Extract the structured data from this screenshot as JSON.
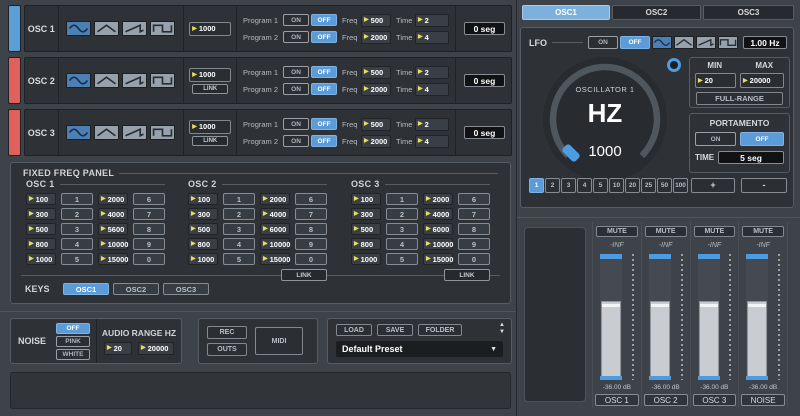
{
  "colors": {
    "accent": "#5b9bd8",
    "osc1_bar": "#5b9fd8",
    "osc2_bar": "#e0605c",
    "osc3_bar": "#e0605c",
    "fader_cap": "#4d9be0"
  },
  "left": {
    "labels": {
      "on": "ON",
      "off": "OFF",
      "freq": "Freq",
      "time": "Time",
      "link": "LINK"
    },
    "osc_rows": [
      {
        "label": "OSC 1",
        "bar_color": "#5b9fd8",
        "value": "1000",
        "display": "0 seg",
        "programs": [
          {
            "label": "Program 1",
            "freq": "500",
            "time": "2"
          },
          {
            "label": "Program 2",
            "freq": "2000",
            "time": "4"
          }
        ]
      },
      {
        "label": "OSC 2",
        "bar_color": "#e0605c",
        "value": "1000",
        "display": "0 seg",
        "programs": [
          {
            "label": "Program 1",
            "freq": "500",
            "time": "2"
          },
          {
            "label": "Program 2",
            "freq": "2000",
            "time": "4"
          }
        ]
      },
      {
        "label": "OSC 3",
        "bar_color": "#e0605c",
        "value": "1000",
        "display": "0 seg",
        "programs": [
          {
            "label": "Program 1",
            "freq": "500",
            "time": "2"
          },
          {
            "label": "Program 2",
            "freq": "2000",
            "time": "4"
          }
        ]
      }
    ],
    "fixed_panel": {
      "title": "FIXED FREQ PANEL",
      "link_label": "LINK",
      "groups": [
        {
          "title": "OSC 1",
          "pairs": [
            [
              "100",
              "1"
            ],
            [
              "300",
              "2"
            ],
            [
              "500",
              "3"
            ],
            [
              "800",
              "4"
            ],
            [
              "1000",
              "5"
            ],
            [
              "2000",
              "6"
            ],
            [
              "4000",
              "7"
            ],
            [
              "5600",
              "8"
            ],
            [
              "10000",
              "9"
            ],
            [
              "15000",
              "0"
            ]
          ]
        },
        {
          "title": "OSC 2",
          "pairs": [
            [
              "100",
              "1"
            ],
            [
              "300",
              "2"
            ],
            [
              "500",
              "3"
            ],
            [
              "800",
              "4"
            ],
            [
              "1000",
              "5"
            ],
            [
              "2000",
              "6"
            ],
            [
              "4000",
              "7"
            ],
            [
              "6000",
              "8"
            ],
            [
              "10000",
              "9"
            ],
            [
              "15000",
              "0"
            ]
          ]
        },
        {
          "title": "OSC 3",
          "pairs": [
            [
              "100",
              "1"
            ],
            [
              "300",
              "2"
            ],
            [
              "500",
              "3"
            ],
            [
              "800",
              "4"
            ],
            [
              "1000",
              "5"
            ],
            [
              "2000",
              "6"
            ],
            [
              "4000",
              "7"
            ],
            [
              "6000",
              "8"
            ],
            [
              "10000",
              "9"
            ],
            [
              "15000",
              "0"
            ]
          ]
        }
      ],
      "keys": {
        "label": "KEYS",
        "buttons": [
          "OSC1",
          "OSC2",
          "OSC3"
        ],
        "active": "OSC1"
      }
    },
    "noise_panel": {
      "label": "NOISE",
      "options": [
        "OFF",
        "PINK",
        "WHITE"
      ],
      "selected": "OFF",
      "range_title": "AUDIO RANGE HZ",
      "min": "20",
      "max": "20000"
    },
    "io_panel": {
      "rec": "REC",
      "outs": "OUTS",
      "midi": "MIDI"
    },
    "preset_panel": {
      "load": "LOAD",
      "save": "SAVE",
      "folder": "FOLDER",
      "preset": "Default Preset"
    }
  },
  "right": {
    "tabs": [
      {
        "label": "OSC1"
      },
      {
        "label": "OSC2"
      },
      {
        "label": "OSC3"
      }
    ],
    "active_tab": "OSC1",
    "lfo": {
      "label": "LFO",
      "on": "ON",
      "off": "OFF",
      "rate": "1.00 Hz"
    },
    "knob": {
      "title": "OSCILLATOR 1",
      "unit": "HZ",
      "value": "1000"
    },
    "range": {
      "min_label": "MIN",
      "max_label": "MAX",
      "min": "20",
      "max": "20000",
      "full_range": "FULL-RANGE"
    },
    "portamento": {
      "title": "PORTAMENTO",
      "on": "ON",
      "off": "OFF",
      "time_label": "TIME",
      "time": "5 seg"
    },
    "increments": {
      "buttons": [
        "1",
        "2",
        "3",
        "4",
        "5",
        "10",
        "20",
        "25",
        "50",
        "100"
      ],
      "active": "1",
      "plus": "+",
      "minus": "-"
    },
    "mixer": {
      "mute_label": "MUTE",
      "inf_label": "-INF",
      "channels": [
        {
          "name": "OSC 1",
          "db": "-36.00 dB"
        },
        {
          "name": "OSC 2",
          "db": "-36.00 dB"
        },
        {
          "name": "OSC 3",
          "db": "-36.00 dB"
        },
        {
          "name": "NOISE",
          "db": "-36.00 dB"
        }
      ]
    }
  }
}
